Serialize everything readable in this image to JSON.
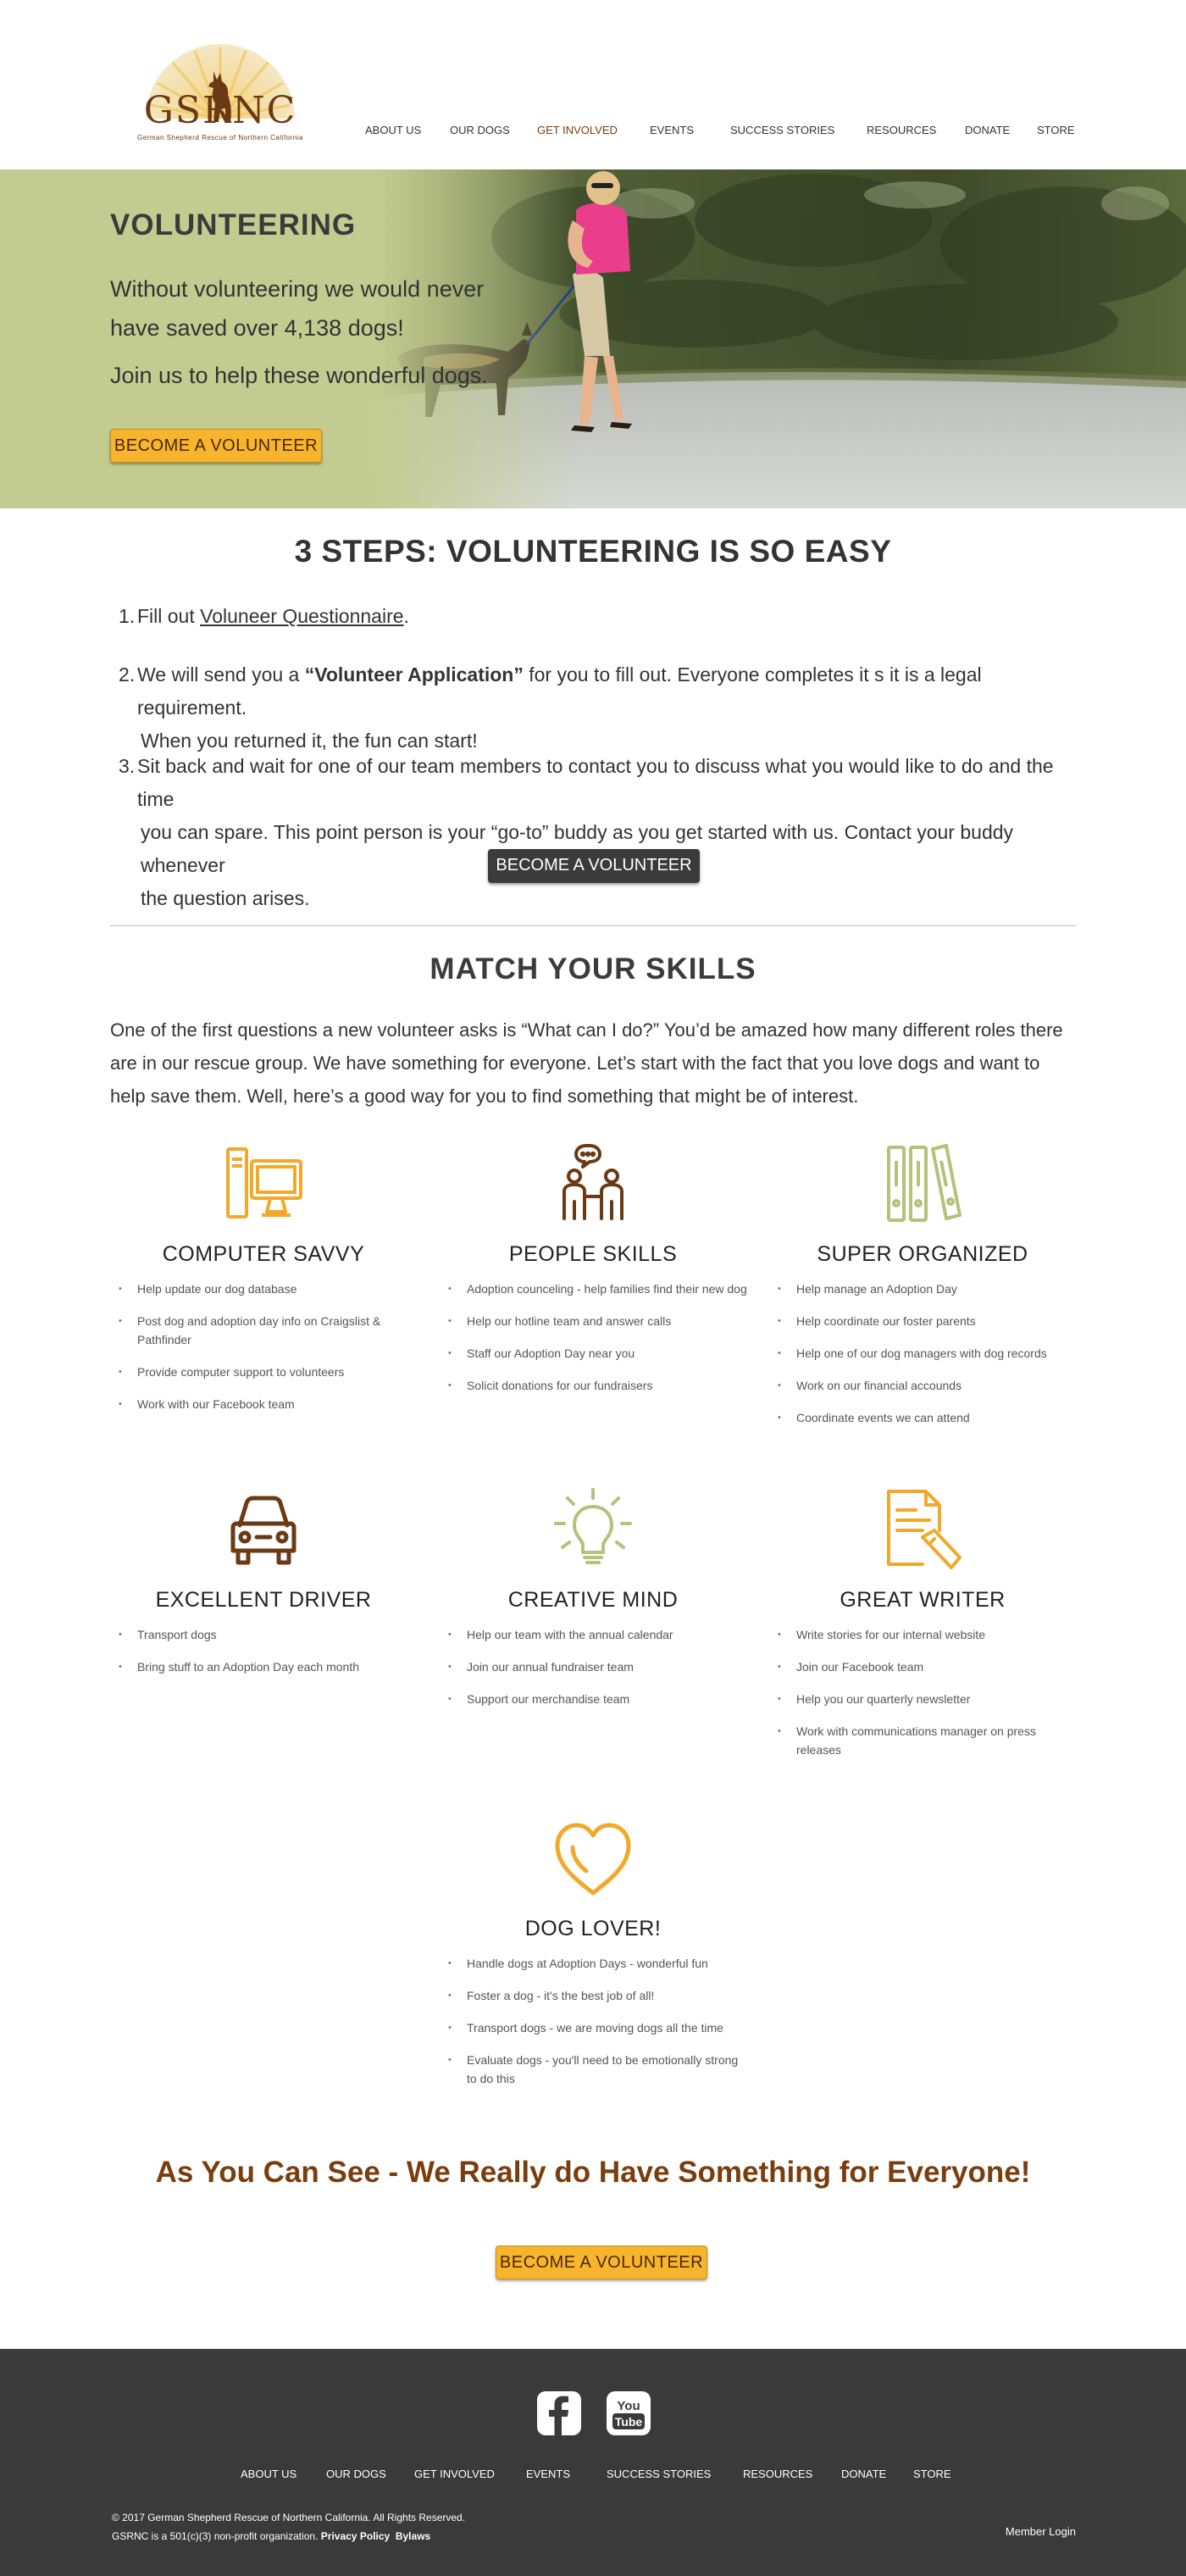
{
  "logo": {
    "text": "GSRNC",
    "tagline": "German Shepherd Rescue of Northern California"
  },
  "nav": [
    {
      "label": "ABOUT US"
    },
    {
      "label": "OUR DOGS"
    },
    {
      "label": "GET INVOLVED",
      "active": true
    },
    {
      "label": "EVENTS"
    },
    {
      "label": "SUCCESS STORIES"
    },
    {
      "label": "RESOURCES"
    },
    {
      "label": "DONATE"
    },
    {
      "label": "STORE"
    }
  ],
  "hero": {
    "title": "VOLUNTEERING",
    "text1": "Without volunteering we would never have saved over 4,138 dogs!",
    "text2": "Join us to help these wonderful dogs.",
    "button": "BECOME A VOLUNTEER"
  },
  "steps": {
    "title": "3 STEPS: VOLUNTEERING IS SO EASY",
    "items": [
      {
        "num": "1.",
        "pre": "Fill out ",
        "link": "Voluneer Questionnaire",
        "post": "."
      },
      {
        "num": "2.",
        "pre": "We will send you a ",
        "bold": "“Volunteer Application”",
        "post": " for you to fill out. Everyone completes it s it is a legal requirement.",
        "cont": "When you returned it, the fun can start!"
      },
      {
        "num": "3.",
        "line1": "Sit back and wait for one of our team members to contact you to discuss what you would like to do and the time",
        "line2": "you can spare. This point person is your “go-to” buddy as you get started with us. Contact your buddy whenever",
        "line3": "the question arises."
      }
    ],
    "button": "BECOME A VOLUNTEER"
  },
  "skills": {
    "title": "MATCH YOUR SKILLS",
    "intro": "One of the first questions a new volunteer asks is “What can I do?” You’d be amazed how many different roles there are in our rescue group. We have something for everyone. Let’s start with the fact that you love dogs and want to help save them. Well, here’s a good way for you to find something that might be of interest.",
    "cards": [
      {
        "title": "COMPUTER SAVVY",
        "icon": "computer-icon",
        "items": [
          "Help update our dog database",
          "Post dog and adoption day info on Craigslist & Pathfinder",
          "Provide computer support to volunteers",
          "Work with our Facebook team"
        ]
      },
      {
        "title": "PEOPLE SKILLS",
        "icon": "people-icon",
        "items": [
          "Adoption counceling - help families find their new dog",
          "Help our hotline team and answer calls",
          "Staff our Adoption Day near you",
          "Solicit donations for our fundraisers"
        ]
      },
      {
        "title": "SUPER ORGANIZED",
        "icon": "binders-icon",
        "items": [
          "Help manage an Adoption Day",
          "Help coordinate our foster parents",
          "Help one of our dog managers with dog records",
          "Work on our financial accounds",
          "Coordinate events we can attend"
        ]
      },
      {
        "title": "EXCELLENT DRIVER",
        "icon": "car-icon",
        "items": [
          "Transport dogs",
          "Bring stuff to an Adoption Day each month"
        ]
      },
      {
        "title": "CREATIVE MIND",
        "icon": "lightbulb-icon",
        "items": [
          "Help our team with the annual calendar",
          "Join our annual fundraiser team",
          "Support our merchandise team"
        ]
      },
      {
        "title": "GREAT WRITER",
        "icon": "document-pen-icon",
        "items": [
          "Write stories for our internal website",
          "Join our Facebook team",
          "Help you our quarterly newsletter",
          "Work with communications manager on press releases"
        ]
      },
      {
        "title": "DOG LOVER!",
        "icon": "heart-icon",
        "items": [
          "Handle dogs at Adoption Days - wonderful fun",
          "Foster a dog - it's the best job of all!",
          "Transport dogs - we are moving dogs all the time",
          "Evaluate dogs - you'll need to be emotionally strong to do this"
        ]
      }
    ]
  },
  "cta": {
    "title": "As You Can See - We Really do Have Something for Everyone!",
    "button": "BECOME A VOLUNTEER"
  },
  "footer": {
    "social": [
      {
        "icon": "facebook-icon"
      },
      {
        "icon": "youtube-icon",
        "line1": "You",
        "line2": "Tube"
      }
    ],
    "nav": [
      {
        "label": "ABOUT US"
      },
      {
        "label": "OUR DOGS"
      },
      {
        "label": "GET INVOLVED"
      },
      {
        "label": "EVENTS"
      },
      {
        "label": "SUCCESS STORIES"
      },
      {
        "label": "RESOURCES"
      },
      {
        "label": "DONATE"
      },
      {
        "label": "STORE"
      }
    ],
    "copyright": "© 2017 German Shepherd Rescue of Northern California. All Rights Reserved.",
    "nonprofit": "GSRNC is a 501(c)(3) non-profit organization.",
    "privacy": "Privacy Policy",
    "bylaws": "Bylaws",
    "member_login": "Member Login"
  },
  "colors": {
    "accent_yellow": "#f7b52d",
    "brand_brown": "#7a3e0e",
    "hero_green": "#c3cc90",
    "icon_green": "#b5c27a",
    "footer_bg": "#3a3a3a"
  }
}
